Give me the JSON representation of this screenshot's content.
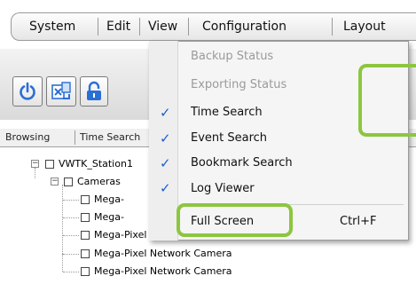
{
  "menubar": {
    "items": [
      "System",
      "Edit",
      "View",
      "Configuration",
      "Layout"
    ]
  },
  "toolbar": {
    "buttons": [
      "power-icon",
      "export-icon",
      "lock-icon",
      "fullscreen-icon"
    ]
  },
  "tabs": {
    "browsing": "Browsing",
    "time_search": "Time Search"
  },
  "tree": {
    "station": "VWTK_Station1",
    "cameras": "Cameras",
    "items": [
      "Mega-",
      "Mega-",
      "Mega-Pixel Network Camera",
      "Mega-Pixel Network Camera",
      "Mega-Pixel Network Camera"
    ]
  },
  "view_menu": {
    "items": [
      {
        "label": "Backup Status",
        "checked": false,
        "enabled": false
      },
      {
        "label": "Exporting Status",
        "checked": false,
        "enabled": false
      },
      {
        "label": "Time Search",
        "checked": true,
        "enabled": true
      },
      {
        "label": "Event Search",
        "checked": true,
        "enabled": true
      },
      {
        "label": "Bookmark Search",
        "checked": true,
        "enabled": true
      },
      {
        "label": "Log Viewer",
        "checked": true,
        "enabled": true
      },
      {
        "label": "Full Screen",
        "checked": false,
        "enabled": true,
        "shortcut": "Ctrl+F"
      }
    ],
    "check_glyph": "✓"
  },
  "colors": {
    "highlight": "#8cc63f",
    "icon_blue": "#2a6fd6"
  }
}
